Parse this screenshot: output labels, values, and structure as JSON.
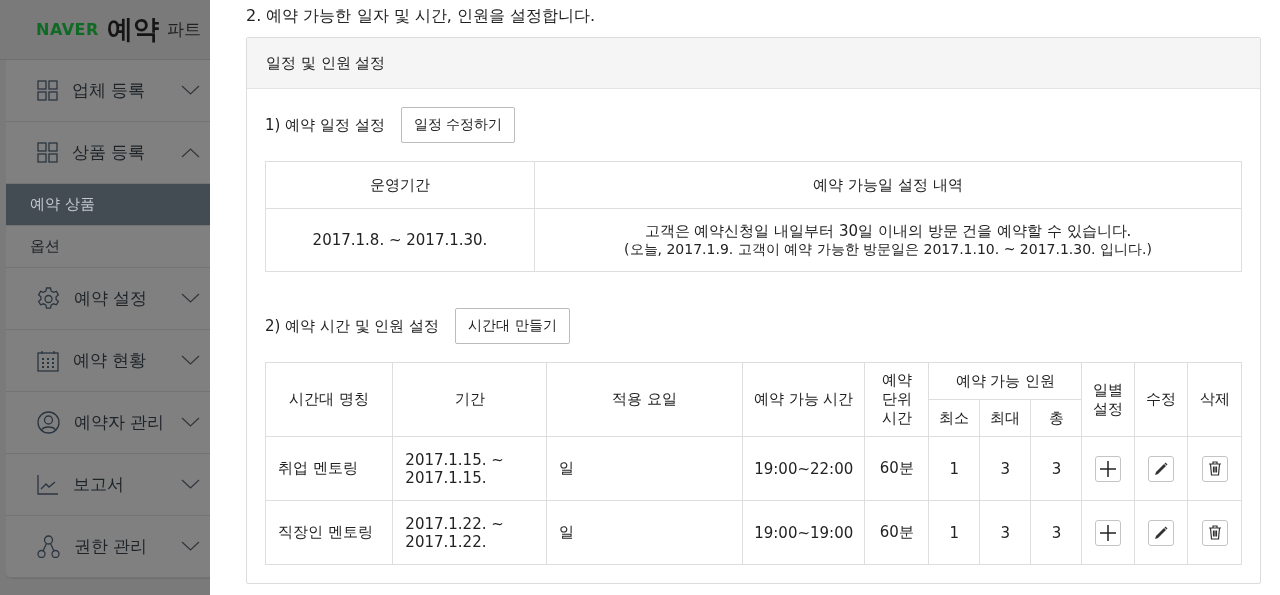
{
  "sidebar": {
    "logo": {
      "brand": "NAVER",
      "title": "예약",
      "subtitle": "파트"
    },
    "items": [
      {
        "label": "업체 등록",
        "expanded": false
      },
      {
        "label": "상품 등록",
        "expanded": true,
        "children": [
          {
            "label": "예약 상품",
            "selected": true
          },
          {
            "label": "옵션",
            "selected": false
          }
        ]
      },
      {
        "label": "예약 설정",
        "expanded": false
      },
      {
        "label": "예약 현황",
        "expanded": false
      },
      {
        "label": "예약자 관리",
        "expanded": false
      },
      {
        "label": "보고서",
        "expanded": false
      },
      {
        "label": "권한 관리",
        "expanded": false
      }
    ]
  },
  "step_title": "2. 예약 가능한 일자 및 시간, 인원을 설정합니다.",
  "panel": {
    "title": "일정 및 인원 설정",
    "schedule": {
      "label": "1) 예약 일정 설정",
      "button": "일정 수정하기",
      "columns": [
        "운영기간",
        "예약 가능일 설정 내역"
      ],
      "rows": [
        {
          "period": "2017.1.8. ~ 2017.1.30.",
          "description": "고객은 예약신청일 내일부터 30일 이내의 방문 건을 예약할 수 있습니다.",
          "note": "(오늘, 2017.1.9. 고객이 예약 가능한 방문일은 2017.1.10. ~ 2017.1.30. 입니다.)"
        }
      ]
    },
    "time_slots": {
      "label": "2) 예약 시간 및 인원 설정",
      "button": "시간대 만들기",
      "columns": [
        {
          "label": "시간대 명칭"
        },
        {
          "label": "기간"
        },
        {
          "label": "적용 요일"
        },
        {
          "label": "예약 가능 시간"
        },
        {
          "label": "예약 단위 시간"
        },
        {
          "label": "예약 가능 인원",
          "children": [
            "최소",
            "최대",
            "총"
          ]
        },
        {
          "label": "일별 설정"
        },
        {
          "label": "수정"
        },
        {
          "label": "삭제"
        }
      ],
      "rows": [
        {
          "name": "취업 멘토링",
          "period": "2017.1.15. ~ 2017.1.15.",
          "days": "일",
          "time": "19:00~22:00",
          "unit": "60분",
          "min": "1",
          "max": "3",
          "total": "3"
        },
        {
          "name": "직장인 멘토링",
          "period": "2017.1.22. ~ 2017.1.22.",
          "days": "일",
          "time": "19:00~19:00",
          "unit": "60분",
          "min": "1",
          "max": "3",
          "total": "3"
        }
      ]
    }
  }
}
